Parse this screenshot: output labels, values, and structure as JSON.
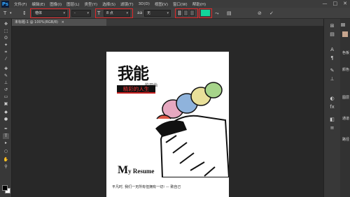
{
  "app": {
    "logo": "Ps"
  },
  "menu": [
    "文件(F)",
    "编辑(E)",
    "图像(I)",
    "图层(L)",
    "类型(Y)",
    "选择(S)",
    "滤镜(T)",
    "3D(D)",
    "视图(V)",
    "窗口(W)",
    "帮助(H)"
  ],
  "window_controls": [
    "—",
    "□",
    "✕"
  ],
  "options": {
    "font_family": "楷体",
    "font_style": "-",
    "font_size": "8 点",
    "antialias": "无",
    "text_color": "#12d49a",
    "accent_highlight": "#e0282a"
  },
  "tab": {
    "label": "未标题-1 @ 100%(RGB/8)",
    "close": "×"
  },
  "document": {
    "title": "我能",
    "subtitle": "的开始",
    "tagline": "精彩的人生",
    "my_resume_first": "M",
    "my_resume_rest": "y Resume",
    "footer": "平凡时, 我们一无所有但拥有一切! — 致自己"
  },
  "tools": [
    "move-icon",
    "marquee-icon",
    "lasso-icon",
    "wand-icon",
    "crop-icon",
    "eyedropper-icon",
    "heal-icon",
    "brush-icon",
    "stamp-icon",
    "history-icon",
    "eraser-icon",
    "gradient-icon",
    "blur-icon",
    "dodge-icon",
    "pen-icon",
    "type-icon",
    "path-select-icon",
    "shape-icon",
    "hand-icon",
    "zoom-icon"
  ],
  "right_panel": {
    "labels": [
      "颜色",
      "色板",
      "图层",
      "通道",
      "路径"
    ]
  }
}
